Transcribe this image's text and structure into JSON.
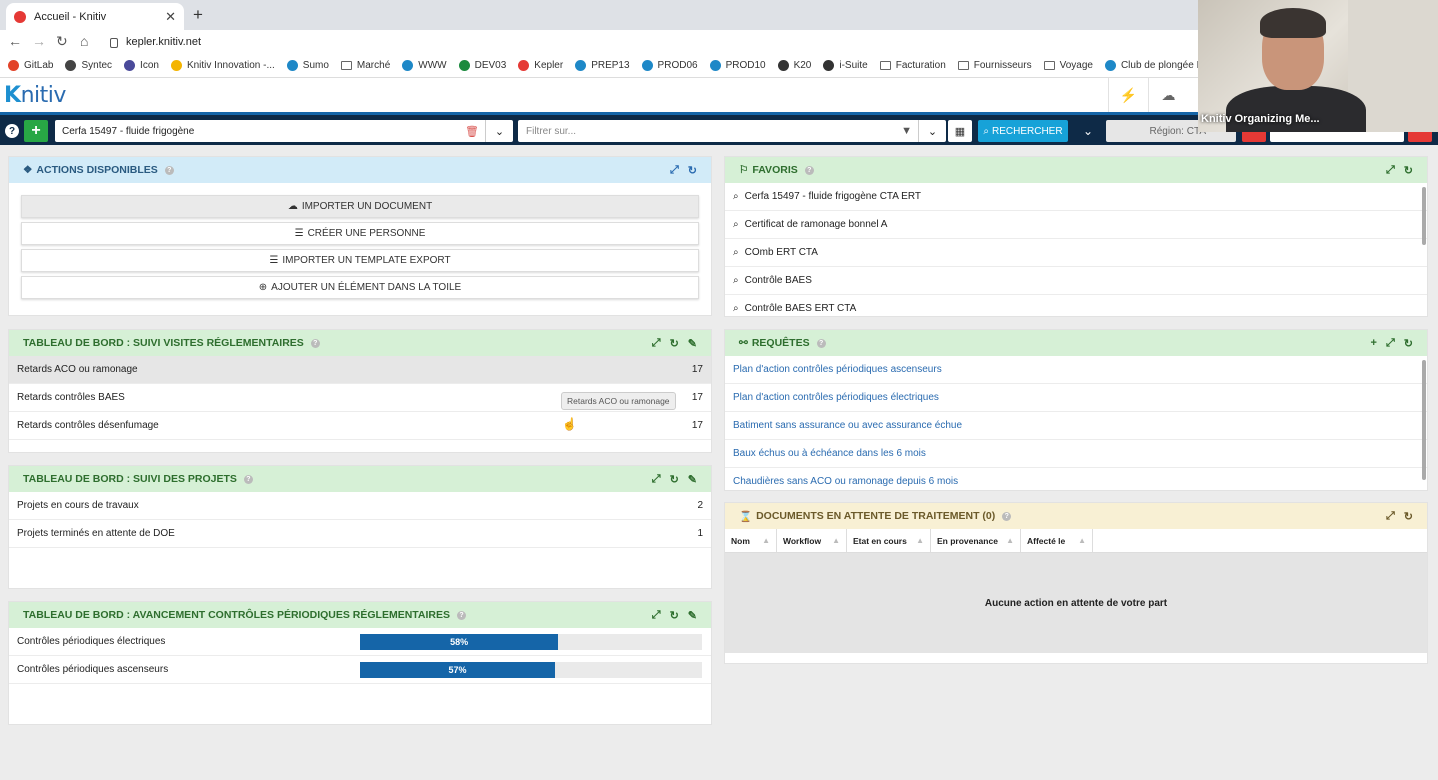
{
  "browser": {
    "tab_title": "Accueil - Knitiv",
    "url": "kepler.knitiv.net",
    "bookmarks": [
      {
        "label": "GitLab",
        "color": "#e24329"
      },
      {
        "label": "Syntec",
        "color": "#444444"
      },
      {
        "label": "Icon",
        "color": "#4a4a9a"
      },
      {
        "label": "Knitiv Innovation -...",
        "color": "#f4b400"
      },
      {
        "label": "Sumo",
        "color": "#1e88c7"
      },
      {
        "label": "Marché",
        "color": "folder"
      },
      {
        "label": "WWW",
        "color": "#1e88c7"
      },
      {
        "label": "DEV03",
        "color": "#1b8a3e"
      },
      {
        "label": "Kepler",
        "color": "#e53935"
      },
      {
        "label": "PREP13",
        "color": "#1e88c7"
      },
      {
        "label": "PROD06",
        "color": "#1e88c7"
      },
      {
        "label": "PROD10",
        "color": "#1e88c7"
      },
      {
        "label": "K20",
        "color": "#333333"
      },
      {
        "label": "i-Suite",
        "color": "#333333"
      },
      {
        "label": "Facturation",
        "color": "folder"
      },
      {
        "label": "Fournisseurs",
        "color": "folder"
      },
      {
        "label": "Voyage",
        "color": "folder"
      },
      {
        "label": "Club de plongée L",
        "color": "#1e88c7"
      }
    ]
  },
  "app": {
    "logo": "nitiv",
    "logo_k": "K"
  },
  "toolbar": {
    "selected_document": "Cerfa 15497 - fluide frigogène",
    "filter_placeholder": "Filtrer sur...",
    "search_label": "RECHERCHER",
    "region_label": "Région: CTA"
  },
  "video": {
    "label": "Knitiv Organizing Me..."
  },
  "actions": {
    "title": "ACTIONS DISPONIBLES",
    "buttons": [
      {
        "label": "IMPORTER UN DOCUMENT",
        "icon": "cloud-upload-icon",
        "glyph": "☁"
      },
      {
        "label": "CRÉER UNE PERSONNE",
        "icon": "list-icon",
        "glyph": "☰"
      },
      {
        "label": "IMPORTER UN TEMPLATE EXPORT",
        "icon": "list-icon",
        "glyph": "☰"
      },
      {
        "label": "AJOUTER UN ÉLÉMENT DANS LA TOILE",
        "icon": "plus-circle-icon",
        "glyph": "⊕"
      }
    ]
  },
  "visites": {
    "title": "TABLEAU DE BORD : SUIVI VISITES RÉGLEMENTAIRES",
    "rows": [
      {
        "label": "Retards ACO ou ramonage",
        "value": "17"
      },
      {
        "label": "Retards contrôles BAES",
        "value": "17"
      },
      {
        "label": "Retards contrôles désenfumage",
        "value": "17"
      }
    ],
    "tooltip": "Retards ACO ou ramonage"
  },
  "projets": {
    "title": "TABLEAU DE BORD : SUIVI DES PROJETS",
    "rows": [
      {
        "label": "Projets en cours de travaux",
        "value": "2"
      },
      {
        "label": "Projets terminés en attente de DOE",
        "value": "1"
      }
    ]
  },
  "avancement": {
    "title": "TABLEAU DE BORD : AVANCEMENT CONTRÔLES PÉRIODIQUES RÉGLEMENTAIRES",
    "rows": [
      {
        "label": "Contrôles périodiques électriques",
        "percent": 58,
        "percent_label": "58%"
      },
      {
        "label": "Contrôles périodiques ascenseurs",
        "percent": 57,
        "percent_label": "57%"
      }
    ]
  },
  "favoris": {
    "title": "FAVORIS",
    "items": [
      "Cerfa 15497 - fluide frigogène CTA ERT",
      "Certificat de ramonage bonnel A",
      "COmb ERT CTA",
      "Contrôle BAES",
      "Contrôle BAES ERT CTA"
    ]
  },
  "requetes": {
    "title": "REQUÊTES",
    "items": [
      "Plan d'action contrôles périodiques ascenseurs",
      "Plan d'action contrôles périodiques électriques",
      "Batiment sans assurance ou avec assurance échue",
      "Baux échus ou à échéance dans les 6 mois",
      "Chaudières sans ACO ou ramonage depuis 6 mois"
    ]
  },
  "documents": {
    "title": "DOCUMENTS EN ATTENTE DE TRAITEMENT (0)",
    "columns": [
      "Nom",
      "Workflow",
      "Etat en cours",
      "En provenance",
      "Affecté le"
    ],
    "empty_message": "Aucune action en attente de votre part"
  }
}
